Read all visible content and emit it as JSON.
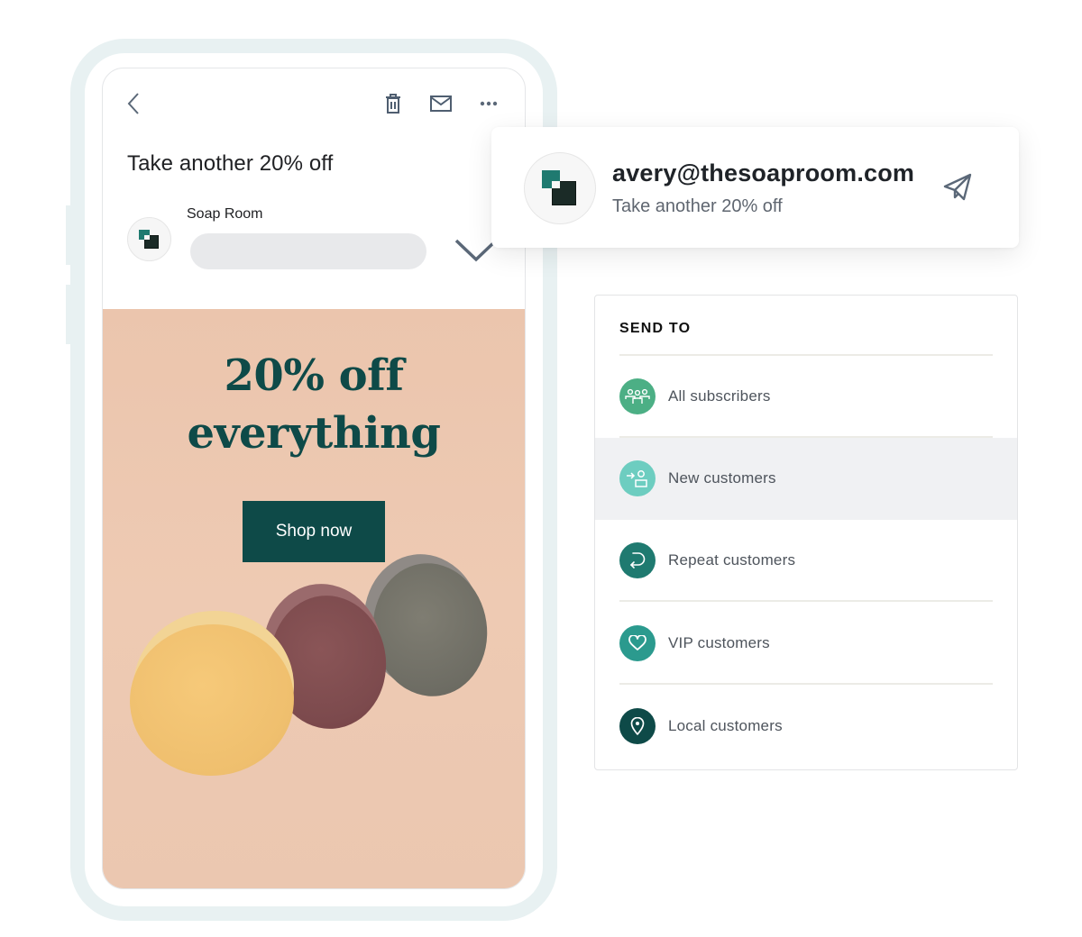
{
  "email_view": {
    "toolbar": {
      "back": "back-icon",
      "delete": "trash-icon",
      "mail": "envelope-icon",
      "more": "more-icon"
    },
    "subject": "Take another 20% off",
    "sender": {
      "name": "Soap Room",
      "avatar": "soap-room-logo"
    },
    "hero": {
      "title_line1": "20% off",
      "title_line2": "everything",
      "cta": "Shop now",
      "background": "#ebc5ad",
      "accent": "#0e4a48"
    }
  },
  "email_card": {
    "from": "avery@thesoaproom.com",
    "subject": "Take another 20% off",
    "send_icon": "paper-plane-icon"
  },
  "send_to": {
    "title": "SEND TO",
    "segments": [
      {
        "label": "All subscribers",
        "icon": "group-icon",
        "color": "#4caf85",
        "active": false
      },
      {
        "label": "New customers",
        "icon": "new-user-icon",
        "color": "#6dcdc0",
        "active": true
      },
      {
        "label": "Repeat customers",
        "icon": "repeat-icon",
        "color": "#1f7a70",
        "active": false
      },
      {
        "label": "VIP customers",
        "icon": "heart-icon",
        "color": "#2b9a8e",
        "active": false
      },
      {
        "label": "Local customers",
        "icon": "location-pin-icon",
        "color": "#0e4a48",
        "active": false
      }
    ]
  }
}
